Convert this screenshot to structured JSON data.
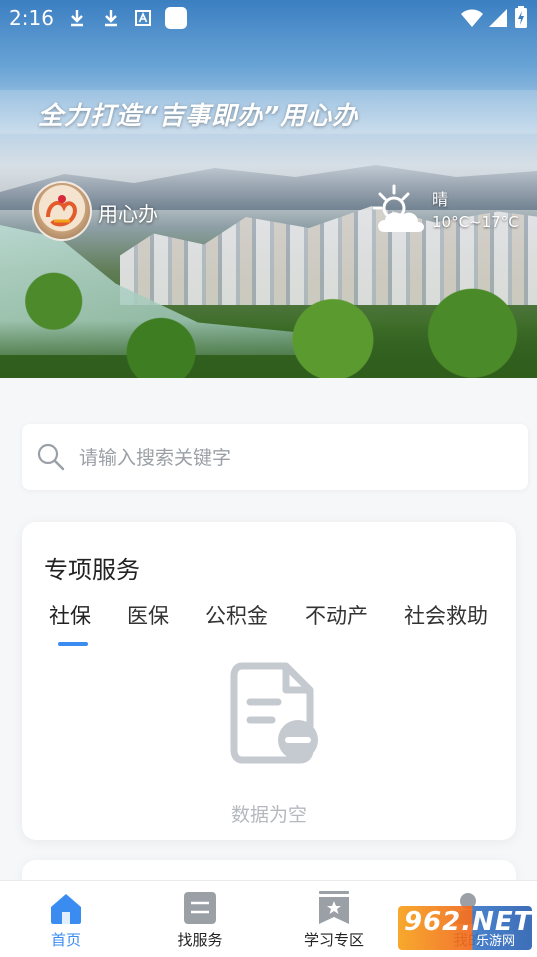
{
  "status_bar": {
    "time": "2:16",
    "icons": [
      "download-icon",
      "download-icon",
      "a-badge-icon",
      "square-icon",
      "wifi-icon",
      "signal-icon",
      "battery-charging-icon"
    ]
  },
  "banner": {
    "slogan": "全力打造“吉事即办”用心办",
    "brand_label": "用心办",
    "weather": {
      "condition": "晴",
      "temperature": "10°C~17°C",
      "icon": "partly-sunny-icon"
    }
  },
  "search": {
    "placeholder": "请输入搜索关键字",
    "value": ""
  },
  "special_services": {
    "title": "专项服务",
    "tabs": [
      {
        "label": "社保",
        "active": true
      },
      {
        "label": "医保",
        "active": false
      },
      {
        "label": "公积金",
        "active": false
      },
      {
        "label": "不动产",
        "active": false
      },
      {
        "label": "社会救助",
        "active": false
      }
    ],
    "empty_text": "数据为空"
  },
  "bottom_nav": {
    "items": [
      {
        "label": "首页",
        "icon": "home-icon",
        "active": true
      },
      {
        "label": "找服务",
        "icon": "list-icon",
        "active": false
      },
      {
        "label": "学习专区",
        "icon": "bookmark-star-icon",
        "active": false
      },
      {
        "label": "我的",
        "icon": "user-icon",
        "active": false
      }
    ]
  },
  "watermark": {
    "big": "962.NET",
    "small": "乐游网"
  },
  "colors": {
    "accent": "#3b8cf0",
    "background": "#f6f7f9",
    "muted": "#b5b9bf"
  }
}
